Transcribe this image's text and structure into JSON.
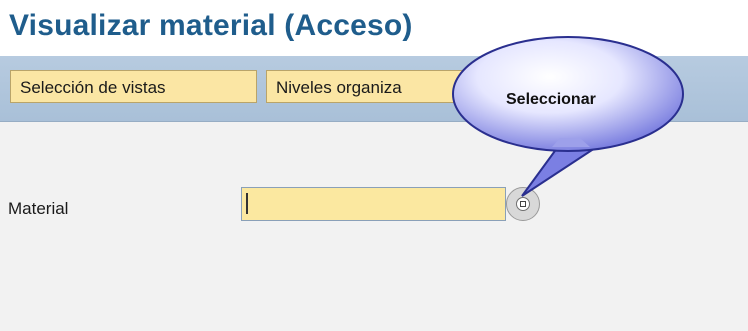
{
  "page": {
    "title": "Visualizar material (Acceso)"
  },
  "toolbar": {
    "buttons": [
      {
        "label": "Selección de vistas"
      },
      {
        "label": "Niveles organiza"
      }
    ]
  },
  "form": {
    "material_label": "Material",
    "material_value": ""
  },
  "callout": {
    "text": "Seleccionar"
  },
  "colors": {
    "title": "#1f5d8c",
    "toolbar": "#b7cbe0",
    "button_bg": "#fbe6a4",
    "input_bg": "#fbe8a0",
    "callout_fill": "#7b7fe3"
  },
  "icons": {
    "f4_help": "value-help-icon"
  }
}
